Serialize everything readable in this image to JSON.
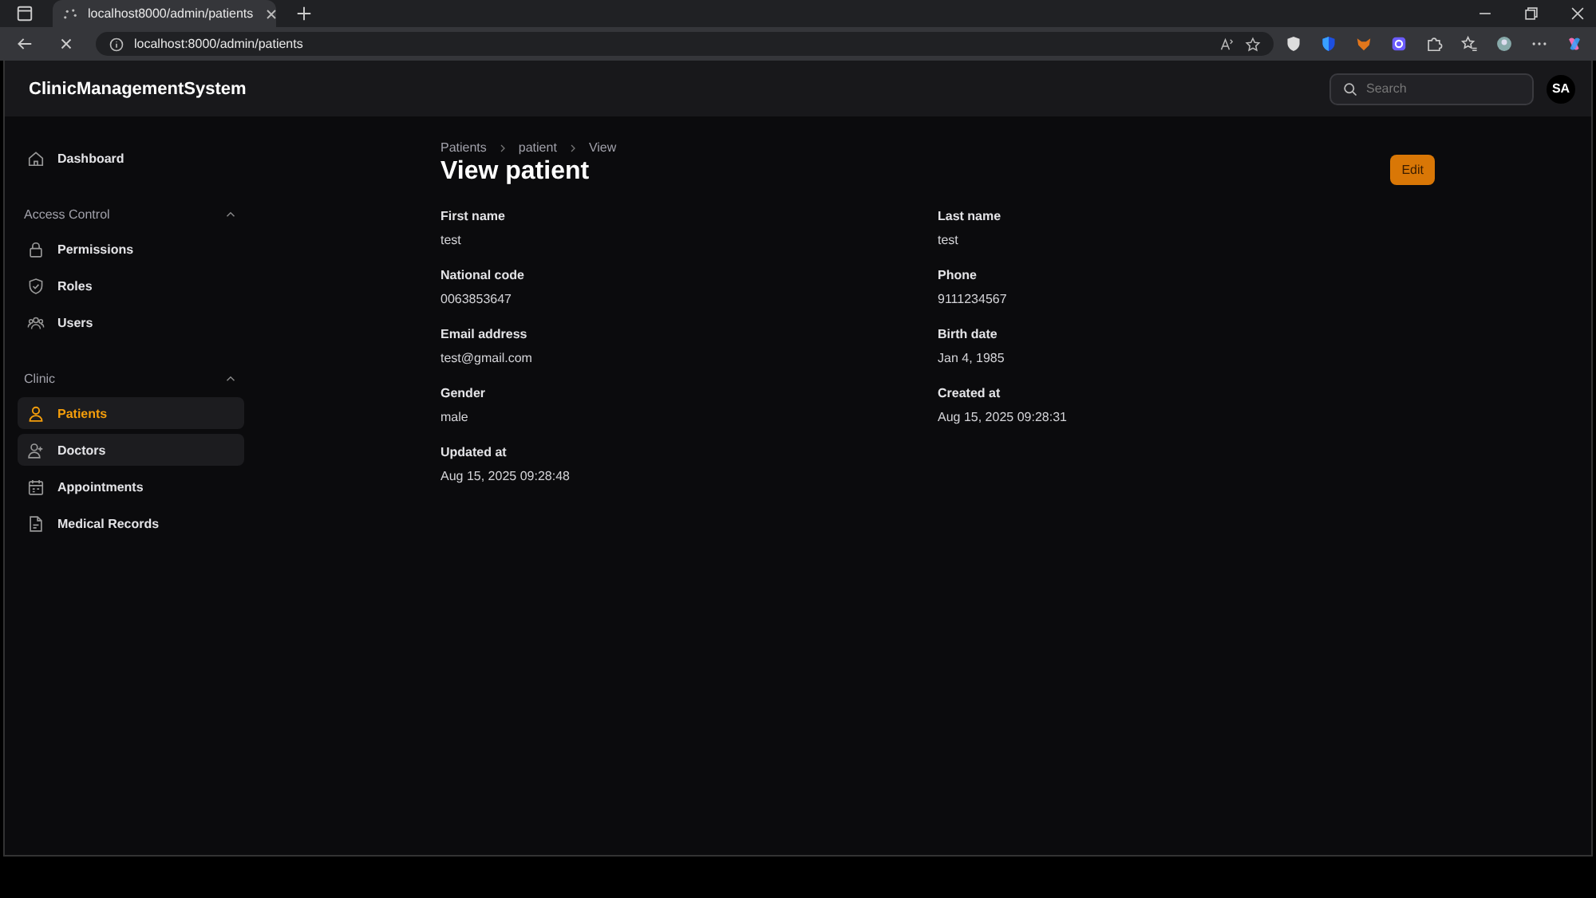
{
  "browser": {
    "tab_title": "localhost8000/admin/patients",
    "url": "localhost:8000/admin/patients"
  },
  "app": {
    "brand": "ClinicManagementSystem",
    "search": {
      "placeholder": "Search"
    },
    "avatar": "SA"
  },
  "sidebar": {
    "groups": [
      {
        "items": [
          {
            "label": "Dashboard",
            "selected": false,
            "hovered": false
          }
        ]
      },
      {
        "title": "Access Control",
        "expanded": true,
        "items": [
          {
            "label": "Permissions",
            "selected": false,
            "hovered": false
          },
          {
            "label": "Roles",
            "selected": false,
            "hovered": false
          },
          {
            "label": "Users",
            "selected": false,
            "hovered": false
          }
        ]
      },
      {
        "title": "Clinic",
        "expanded": true,
        "items": [
          {
            "label": "Patients",
            "selected": true,
            "hovered": false
          },
          {
            "label": "Doctors",
            "selected": false,
            "hovered": true
          },
          {
            "label": "Appointments",
            "selected": false,
            "hovered": false
          },
          {
            "label": "Medical Records",
            "selected": false,
            "hovered": false
          }
        ]
      }
    ]
  },
  "breadcrumbs": [
    "Patients",
    "patient",
    "View"
  ],
  "page_title": "View patient",
  "edit_button": "Edit",
  "fields": [
    {
      "label": "First name",
      "value": "test"
    },
    {
      "label": "Last name",
      "value": "test"
    },
    {
      "label": "National code",
      "value": "0063853647"
    },
    {
      "label": "Phone",
      "value": "9111234567"
    },
    {
      "label": "Email address",
      "value": "test@gmail.com"
    },
    {
      "label": "Birth date",
      "value": "Jan 4, 1985"
    },
    {
      "label": "Gender",
      "value": "male"
    },
    {
      "label": "Created at",
      "value": "Aug 15, 2025 09:28:31"
    },
    {
      "label": "Updated at",
      "value": "Aug 15, 2025 09:28:48"
    }
  ]
}
